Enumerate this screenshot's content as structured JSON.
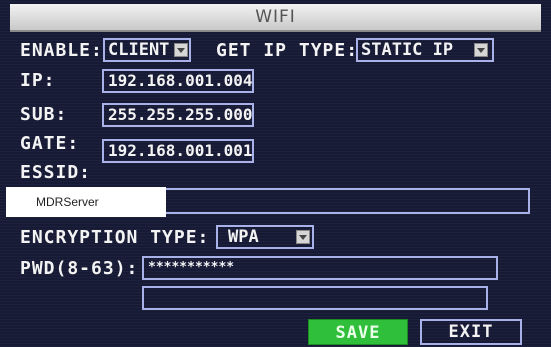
{
  "window": {
    "title": "WIFI"
  },
  "enable": {
    "label": "ENABLE:",
    "value": "CLIENT"
  },
  "get_ip_type": {
    "label": "GET IP TYPE:",
    "value": "STATIC IP"
  },
  "ip": {
    "label": "IP:",
    "value": "192.168.001.004"
  },
  "sub": {
    "label": "SUB:",
    "value": "255.255.255.000"
  },
  "gate": {
    "label": "GATE:",
    "value": "192.168.001.001"
  },
  "essid": {
    "label": "ESSID:",
    "value": "MDRServer"
  },
  "encryption": {
    "label": "ENCRYPTION TYPE:",
    "value": "WPA"
  },
  "pwd": {
    "label": "PWD(8-63):",
    "value": "***********",
    "confirm": ""
  },
  "buttons": {
    "save": "SAVE",
    "exit": "EXIT"
  },
  "colors": {
    "accent": "#a8b2e8",
    "save": "#2fbf3a",
    "background": "#161a35"
  }
}
